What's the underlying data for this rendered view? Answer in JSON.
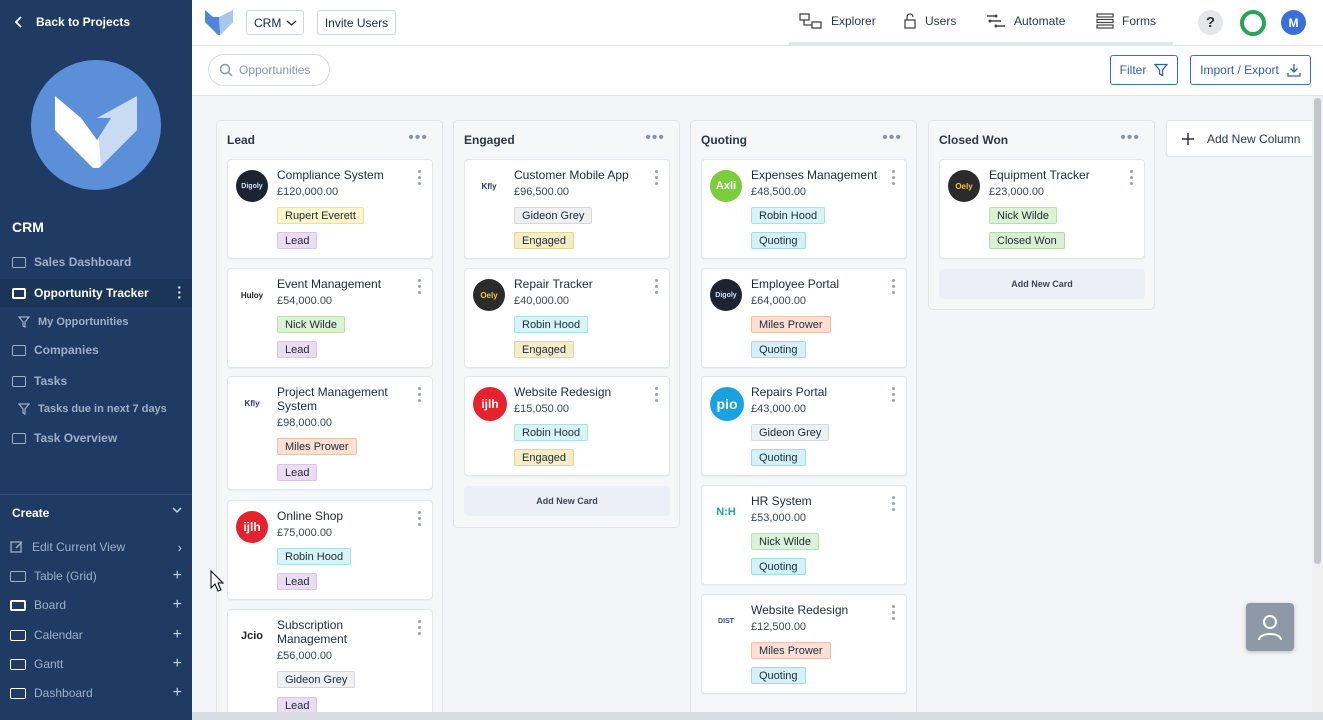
{
  "sidebar": {
    "back_label": "Back to Projects",
    "section_title": "CRM",
    "items": [
      {
        "label": "Sales Dashboard"
      },
      {
        "label": "Opportunity Tracker"
      },
      {
        "label": "My Opportunities"
      },
      {
        "label": "Companies"
      },
      {
        "label": "Tasks"
      },
      {
        "label": "Tasks due in next 7 days"
      },
      {
        "label": "Task Overview"
      }
    ],
    "create": {
      "title": "Create",
      "items": [
        {
          "label": "Edit Current View"
        },
        {
          "label": "Table (Grid)"
        },
        {
          "label": "Board"
        },
        {
          "label": "Calendar"
        },
        {
          "label": "Gantt"
        },
        {
          "label": "Dashboard"
        }
      ]
    }
  },
  "topbar": {
    "app_select": "CRM",
    "invite_label": "Invite Users",
    "nav": [
      {
        "label": "Explorer"
      },
      {
        "label": "Users"
      },
      {
        "label": "Automate"
      },
      {
        "label": "Forms"
      }
    ],
    "help": "?",
    "avatar_initial": "M"
  },
  "toolbar": {
    "search_placeholder": "Opportunities",
    "filter_label": "Filter",
    "import_label": "Import / Export"
  },
  "colors": {
    "sidebar": "#1f3b63",
    "accent": "#3a6fd8",
    "tag_person_yellow": "#fbf6cc",
    "tag_person_green": "#dcf2d4",
    "tag_person_orange": "#fbe0d3",
    "tag_person_cyan": "#d8f4f7",
    "tag_person_grey": "#eef0f3",
    "tag_lead": "#ecdcf3",
    "tag_engaged": "#f5edc8",
    "tag_quoting": "#d3f1f7",
    "tag_won": "#d9f1d2"
  },
  "board": {
    "add_card_label": "Add New Card",
    "add_column_label": "Add New Column",
    "columns": [
      {
        "title": "Lead",
        "cards": [
          {
            "title": "Compliance System",
            "price": "£120,000.00",
            "person": "Rupert Everett",
            "stage": "Lead",
            "logo": "Digoly"
          },
          {
            "title": "Event Management",
            "price": "£54,000.00",
            "person": "Nick Wilde",
            "stage": "Lead",
            "logo": "Huloy"
          },
          {
            "title": "Project Management System",
            "price": "£98,000.00",
            "person": "Miles Prower",
            "stage": "Lead",
            "logo": "Kfly"
          },
          {
            "title": "Online Shop",
            "price": "£75,000.00",
            "person": "Robin Hood",
            "stage": "Lead",
            "logo": "ijlh"
          },
          {
            "title": "Subscription Management",
            "price": "£56,000.00",
            "person": "Gideon Grey",
            "stage": "Lead",
            "logo": "Jcio"
          }
        ]
      },
      {
        "title": "Engaged",
        "cards": [
          {
            "title": "Customer Mobile App",
            "price": "£96,500.00",
            "person": "Gideon Grey",
            "stage": "Engaged",
            "logo": "Kfly"
          },
          {
            "title": "Repair Tracker",
            "price": "£40,000.00",
            "person": "Robin Hood",
            "stage": "Engaged",
            "logo": "Oely"
          },
          {
            "title": "Website Redesign",
            "price": "£15,050.00",
            "person": "Robin Hood",
            "stage": "Engaged",
            "logo": "ijlh"
          }
        ]
      },
      {
        "title": "Quoting",
        "cards": [
          {
            "title": "Expenses Management",
            "price": "£48,500.00",
            "person": "Robin Hood",
            "stage": "Quoting",
            "logo": "Axli"
          },
          {
            "title": "Employee Portal",
            "price": "£64,000.00",
            "person": "Miles Prower",
            "stage": "Quoting",
            "logo": "Digoly"
          },
          {
            "title": "Repairs Portal",
            "price": "£43,000.00",
            "person": "Gideon Grey",
            "stage": "Quoting",
            "logo": "pio"
          },
          {
            "title": "HR System",
            "price": "£53,000.00",
            "person": "Nick Wilde",
            "stage": "Quoting",
            "logo": "N:H"
          },
          {
            "title": "Website Redesign",
            "price": "£12,500.00",
            "person": "Miles Prower",
            "stage": "Quoting",
            "logo": "DIST"
          }
        ]
      },
      {
        "title": "Closed Won",
        "cards": [
          {
            "title": "Equipment Tracker",
            "price": "£23,000.00",
            "person": "Nick Wilde",
            "stage": "Closed Won",
            "logo": "Oely"
          }
        ]
      }
    ]
  }
}
